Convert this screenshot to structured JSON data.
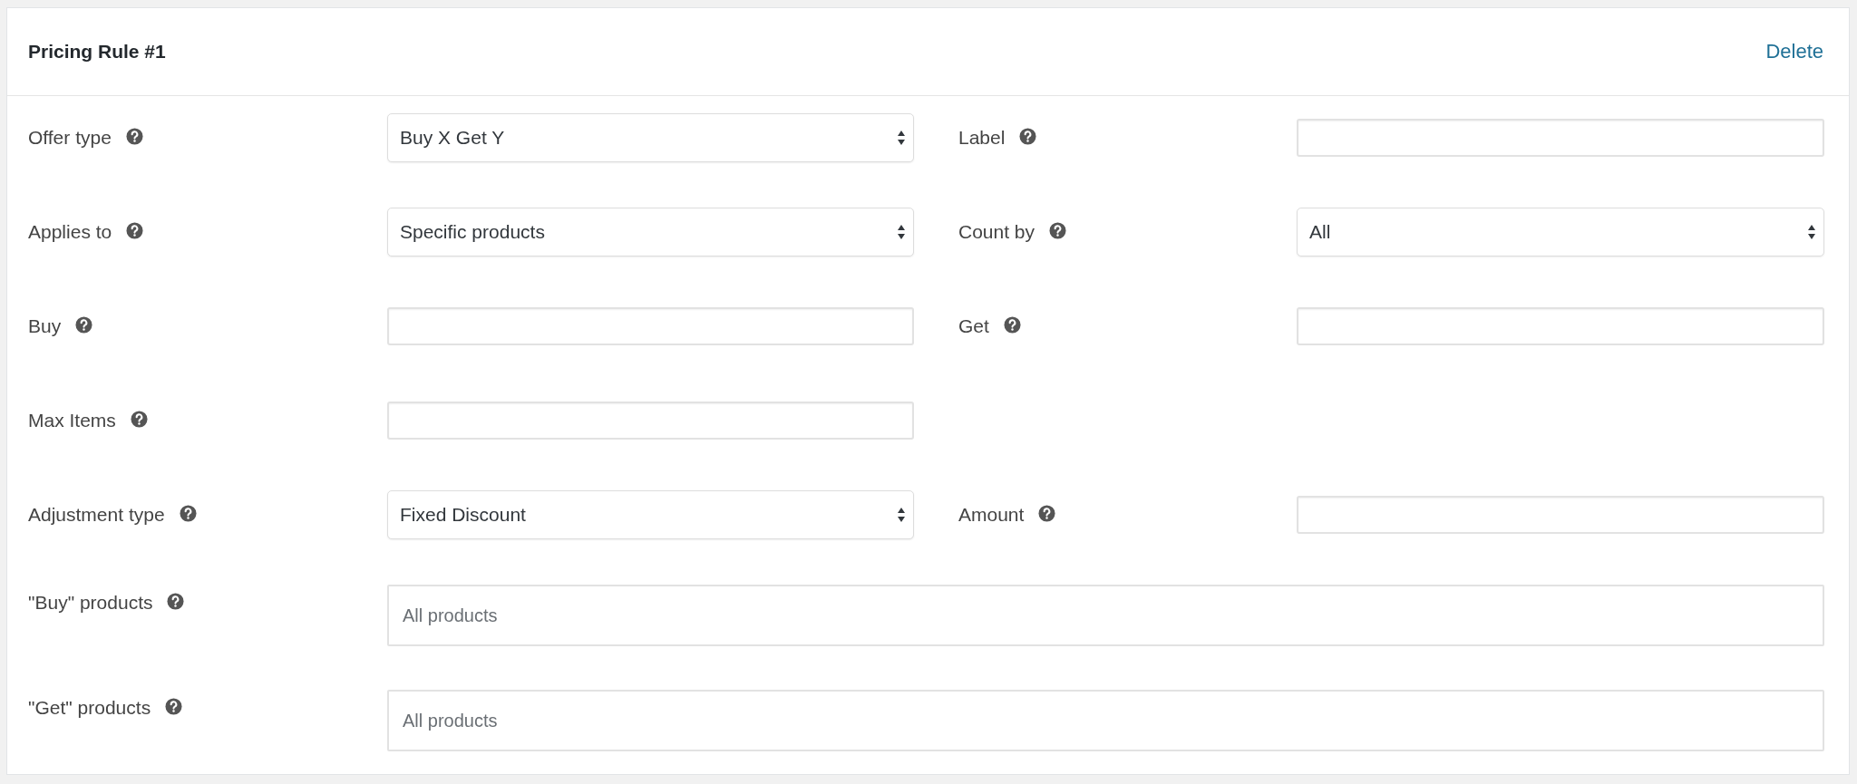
{
  "header": {
    "title": "Pricing Rule #1",
    "delete_link": "Delete"
  },
  "rows": [
    {
      "fields": [
        {
          "label": "Offer type",
          "kind": "select",
          "value": "Buy X Get Y"
        },
        {
          "label": "Label",
          "kind": "text"
        }
      ]
    },
    {
      "fields": [
        {
          "label": "Applies to",
          "kind": "select",
          "value": "Specific products"
        },
        {
          "label": "Count by",
          "kind": "select",
          "value": "All"
        }
      ]
    },
    {
      "fields": [
        {
          "label": "Buy",
          "kind": "text"
        },
        {
          "label": "Get",
          "kind": "text"
        }
      ]
    },
    {
      "fields": [
        {
          "label": "Max Items",
          "kind": "text"
        }
      ]
    },
    {
      "fields": [
        {
          "label": "Adjustment type",
          "kind": "select",
          "value": "Fixed Discount"
        },
        {
          "label": "Amount",
          "kind": "text"
        }
      ]
    },
    {
      "fields": [
        {
          "label": "\"Buy\" products",
          "kind": "tags",
          "placeholder": "All products"
        }
      ]
    },
    {
      "fields": [
        {
          "label": "\"Get\" products",
          "kind": "tags",
          "placeholder": "All products"
        }
      ]
    }
  ]
}
